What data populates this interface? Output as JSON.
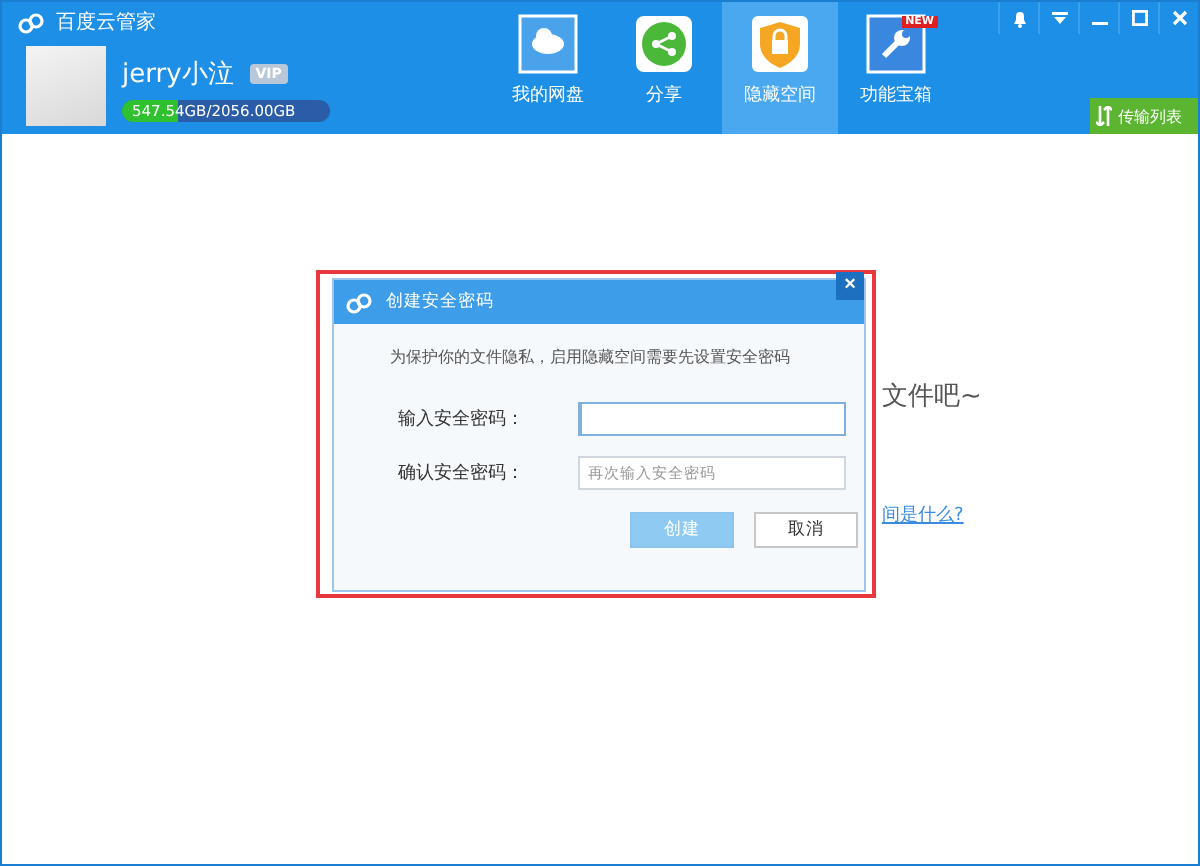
{
  "app": {
    "title": "百度云管家"
  },
  "user": {
    "name": "jerry小泣",
    "vip": "VIP",
    "storage": {
      "text": "547.54GB/2056.00GB",
      "level": 0.27
    }
  },
  "nav": [
    {
      "label": "我的网盘",
      "selected": false
    },
    {
      "label": "分享",
      "selected": false
    },
    {
      "label": "隐藏空间",
      "selected": true
    },
    {
      "label": "功能宝箱",
      "selected": false,
      "badge": "NEW"
    }
  ],
  "transfer_button": "传输列表",
  "background": {
    "hint": "文件吧~",
    "link": "间是什么?"
  },
  "dialog": {
    "title": "创建安全密码",
    "close": "×",
    "description": "为保护你的文件隐私，启用隐藏空间需要先设置安全密码",
    "fields": [
      {
        "label": "输入安全密码：",
        "focused": true
      },
      {
        "label": "确认安全密码：",
        "placeholder": "再次输入安全密码",
        "focused": false
      }
    ],
    "buttons": [
      {
        "label": "创建",
        "kind": "primary"
      },
      {
        "label": "取消",
        "kind": "secondary"
      }
    ]
  }
}
